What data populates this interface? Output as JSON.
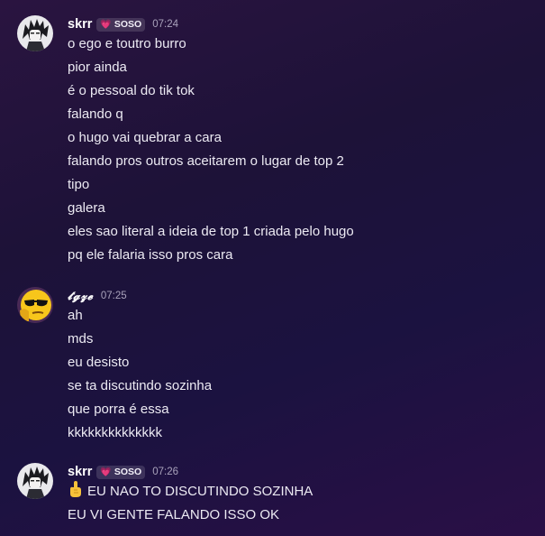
{
  "groups": [
    {
      "username": "skrr",
      "tag": "SOSO",
      "time": "07:24",
      "avatar": "anime-avatar",
      "lines": [
        "o ego e toutro burro",
        "pior ainda",
        "é o pessoal do tik tok",
        "falando q",
        "o hugo vai quebrar a cara",
        "falando pros outros aceitarem o lugar de top 2",
        "tipo",
        "galera",
        "eles sao literal a ideia de top 1 criada pelo hugo",
        "pq ele falaria isso pros cara"
      ]
    },
    {
      "username": "𝓽𝓰𝔃𝓮",
      "time": "07:25",
      "avatar": "sunglasses-emoji-avatar",
      "lines": [
        "ah",
        "mds",
        "eu desisto",
        "se ta discutindo sozinha",
        "que porra é essa",
        "kkkkkkkkkkkkkk"
      ]
    },
    {
      "username": "skrr",
      "tag": "SOSO",
      "time": "07:26",
      "avatar": "anime-avatar",
      "lines": [
        "EU NAO TO DISCUTINDO SOZINHA",
        "EU VI GENTE FALANDO ISSO OK"
      ],
      "first_line_icon": "pointing-up-hand-icon"
    }
  ]
}
